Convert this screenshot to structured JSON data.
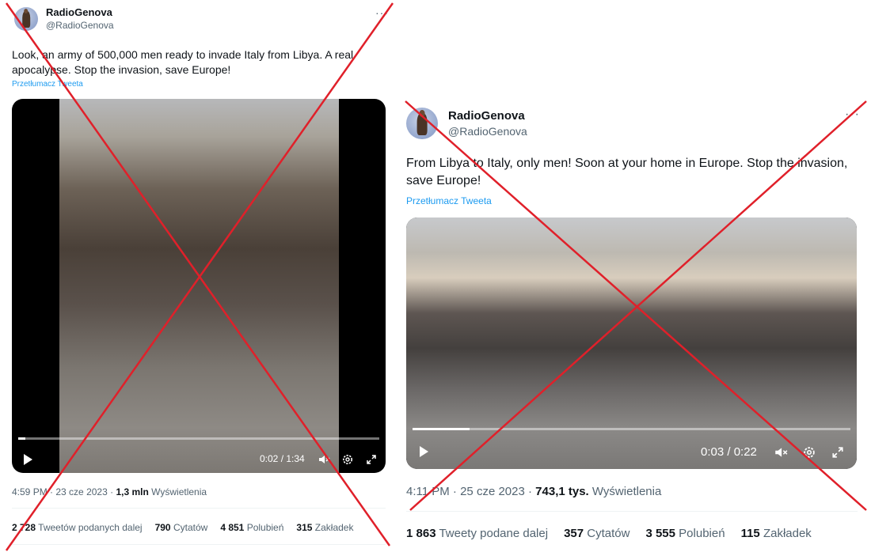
{
  "colors": {
    "accent": "#1d9bf0",
    "cross": "#e0202a",
    "text": "#0f1419",
    "muted": "#536471"
  },
  "left": {
    "name": "RadioGenova",
    "handle": "@RadioGenova",
    "more": "···",
    "text": "Look, an army of 500,000 men ready to invade Italy from Libya. A real apocalypse. Stop the invasion, save Europe!",
    "translate": "Przetłumacz Tweeta",
    "video": {
      "time": "0:02 / 1:34",
      "progress": 0.02
    },
    "meta": {
      "time": "4:59 PM",
      "date": "23 cze 2023",
      "views_num": "1,3 mln",
      "views_label": "Wyświetlenia"
    },
    "stats": [
      {
        "num": "2 728",
        "label": "Tweetów podanych dalej"
      },
      {
        "num": "790",
        "label": "Cytatów"
      },
      {
        "num": "4 851",
        "label": "Polubień"
      },
      {
        "num": "315",
        "label": "Zakładek"
      }
    ]
  },
  "right": {
    "name": "RadioGenova",
    "handle": "@RadioGenova",
    "more": "···",
    "text": "From Libya to Italy, only men! Soon at your home in Europe. Stop the invasion, save Europe!",
    "translate": "Przetłumacz Tweeta",
    "video": {
      "time": "0:03 / 0:22",
      "progress": 0.13
    },
    "meta": {
      "time": "4:11 PM",
      "date": "25 cze 2023",
      "views_num": "743,1 tys.",
      "views_label": "Wyświetlenia"
    },
    "stats": [
      {
        "num": "1 863",
        "label": "Tweety podane dalej"
      },
      {
        "num": "357",
        "label": "Cytatów"
      },
      {
        "num": "3 555",
        "label": "Polubień"
      },
      {
        "num": "115",
        "label": "Zakładek"
      }
    ]
  },
  "icons": {
    "play": "play-icon",
    "volume": "volume-muted-icon",
    "settings": "gear-icon",
    "fullscreen": "fullscreen-icon",
    "more": "more-icon"
  }
}
